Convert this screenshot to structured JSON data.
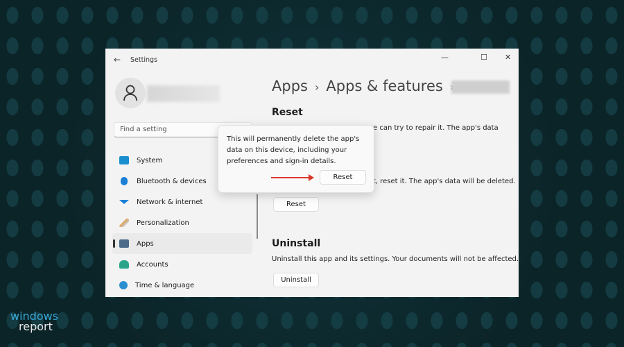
{
  "window": {
    "title": "Settings",
    "back_icon": "arrow-left-icon",
    "controls": [
      "minimize",
      "maximize",
      "close"
    ]
  },
  "sidebar": {
    "search_placeholder": "Find a setting",
    "items": [
      {
        "label": "System",
        "icon": "monitor-icon",
        "color": "#1a8fcf"
      },
      {
        "label": "Bluetooth & devices",
        "icon": "bluetooth-icon",
        "color": "#1b7fd6"
      },
      {
        "label": "Network & internet",
        "icon": "wifi-icon",
        "color": "#1b7fd6"
      },
      {
        "label": "Personalization",
        "icon": "brush-icon",
        "color": "#e0a050"
      },
      {
        "label": "Apps",
        "icon": "apps-icon",
        "color": "#4a6a8a",
        "selected": true
      },
      {
        "label": "Accounts",
        "icon": "person-icon",
        "color": "#2aa58c"
      },
      {
        "label": "Time & language",
        "icon": "globe-clock-icon",
        "color": "#2a8fd0"
      }
    ]
  },
  "breadcrumb": [
    "Apps",
    "Apps & features"
  ],
  "reset": {
    "heading": "Reset",
    "repair_text_visible": "e can try to repair it. The app's data",
    "reset_text_visible": "t, reset it. The app's data will be deleted.",
    "button": "Reset"
  },
  "flyout": {
    "message": "This will permanently delete the app's data on this device, including your preferences and sign-in details.",
    "button": "Reset"
  },
  "uninstall": {
    "heading": "Uninstall",
    "text": "Uninstall this app and its settings. Your documents will not be affected.",
    "button": "Uninstall"
  },
  "watermark": {
    "line1": "windows",
    "line2": "report"
  }
}
